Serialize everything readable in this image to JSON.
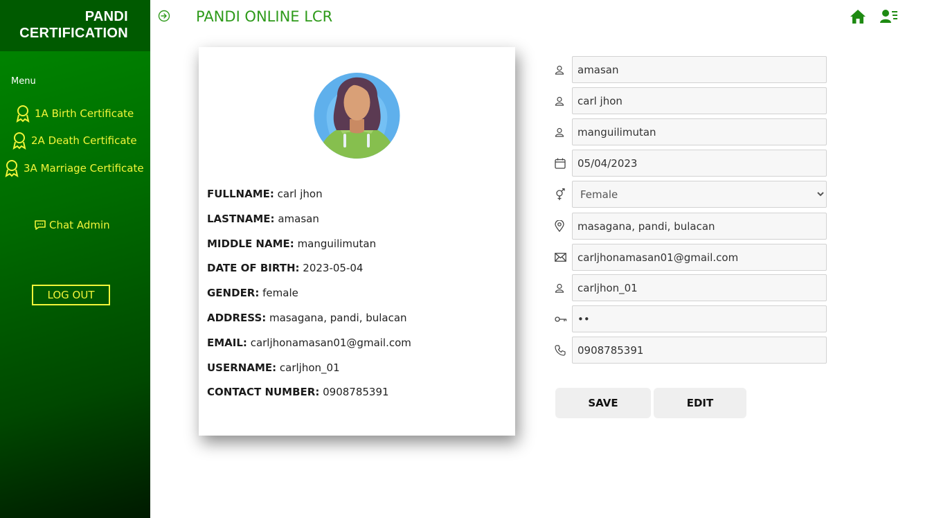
{
  "brand": {
    "line1": "PANDI",
    "line2": "CERTIFICATION"
  },
  "sidebar": {
    "menu_label": "Menu",
    "items": [
      {
        "label": "1A Birth Certificate",
        "icon": "award-icon"
      },
      {
        "label": "2A Death Certificate",
        "icon": "award-icon"
      },
      {
        "label": "3A Marriage Certificate",
        "icon": "award-icon"
      }
    ],
    "chat_label": "Chat Admin",
    "logout_label": "LOG OUT"
  },
  "header": {
    "title": "PANDI ONLINE LCR"
  },
  "profile": {
    "fullname": {
      "label": "FULLNAME:",
      "value": "carl jhon"
    },
    "lastname": {
      "label": "LASTNAME:",
      "value": "amasan"
    },
    "middlename": {
      "label": "MIDDLE NAME:",
      "value": "manguilimutan"
    },
    "dob": {
      "label": "DATE OF BIRTH:",
      "value": "2023-05-04"
    },
    "gender": {
      "label": "GENDER:",
      "value": "female"
    },
    "address": {
      "label": "ADDRESS:",
      "value": "masagana, pandi, bulacan"
    },
    "email": {
      "label": "EMAIL:",
      "value": "carljhonamasan01@gmail.com"
    },
    "username": {
      "label": "USERNAME:",
      "value": "carljhon_01"
    },
    "contact": {
      "label": "CONTACT NUMBER:",
      "value": "0908785391"
    }
  },
  "form": {
    "lastname": "amasan",
    "firstname": "carl jhon",
    "middlename": "manguilimutan",
    "dob": "05/04/2023",
    "gender": "Female",
    "address": "masagana, pandi, bulacan",
    "email": "carljhonamasan01@gmail.com",
    "username": "carljhon_01",
    "password": "••",
    "contact": "0908785391"
  },
  "buttons": {
    "save": "SAVE",
    "edit": "EDIT"
  },
  "colors": {
    "accent": "#2e9a1a",
    "sidebar_dark": "#005a00",
    "nav_text": "#f2f53a"
  }
}
